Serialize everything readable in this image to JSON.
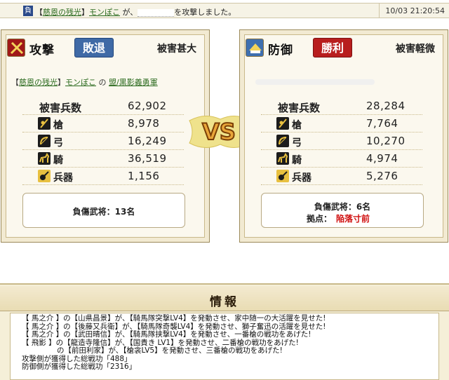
{
  "log": {
    "badge": "負",
    "pre": "【",
    "alliance": "慈恩の残光",
    "mid": "】",
    "player": "モンぽこ",
    "ga": " が、",
    "suffix": "を攻撃しました。",
    "time": "10/03 21:20:54"
  },
  "attacker": {
    "title": "攻撃",
    "result": "敗退",
    "damage": "被害甚大",
    "owner_pre": "【",
    "owner_alliance": "慈恩の残光",
    "owner_mid": "】",
    "owner_player": "モンぽこ",
    "owner_no": " の ",
    "owner_unit": "盟/黒影義勇軍",
    "total_label": "被害兵数",
    "total_value": "62,902",
    "rows": [
      {
        "label": "槍",
        "value": "8,978",
        "icon": "spear-icon"
      },
      {
        "label": "弓",
        "value": "16,249",
        "icon": "bow-icon"
      },
      {
        "label": "騎",
        "value": "36,519",
        "icon": "horse-icon"
      },
      {
        "label": "兵器",
        "value": "1,156",
        "icon": "siege-weapon-icon"
      }
    ],
    "injured": "負傷武将：13名"
  },
  "defender": {
    "title": "防御",
    "result": "勝利",
    "damage": "被害軽微",
    "total_label": "被害兵数",
    "total_value": "28,284",
    "rows": [
      {
        "label": "槍",
        "value": "7,764",
        "icon": "spear-icon"
      },
      {
        "label": "弓",
        "value": "10,270",
        "icon": "bow-icon"
      },
      {
        "label": "騎",
        "value": "4,974",
        "icon": "horse-icon"
      },
      {
        "label": "兵器",
        "value": "5,276",
        "icon": "siege-weapon-icon"
      }
    ],
    "injured": "負傷武将：6名",
    "base_label": "拠点：",
    "base_value": "陥落寸前"
  },
  "vs": "VS",
  "info": {
    "title": "情報",
    "lines": [
      "【 馬之介 】の【山県昌景】が、【騎馬隊突撃LV4】を発動させ、家中随一の大活躍を見せた!",
      "【 馬之介 】の【後藤又兵衛】が、【騎馬隊奇襲LV4】を発動させ、獅子奮迅の活躍を見せた!",
      "【 馬之介 】の【武田晴信】が、【騎馬隊挟撃LV4】を発動させ、一番槍の戦功をあげた!",
      "【 飛影 】の【龍造寺隆信】が、【国貴き LV1】を発動させ、二番槍の戦功をあげた!",
      "の【前田利家】が、【槍衾LV5】を発動させ、三番槍の戦功をあげた!",
      "攻撃側が獲得した総戦功「488」",
      "防御側が獲得した総戦功「2316」"
    ]
  },
  "colors": {
    "lose": "#3f6aa6",
    "win": "#b81e1e",
    "red_text": "#d01010",
    "link": "#2a6a1d",
    "panel_bg": "#f2ead2"
  }
}
